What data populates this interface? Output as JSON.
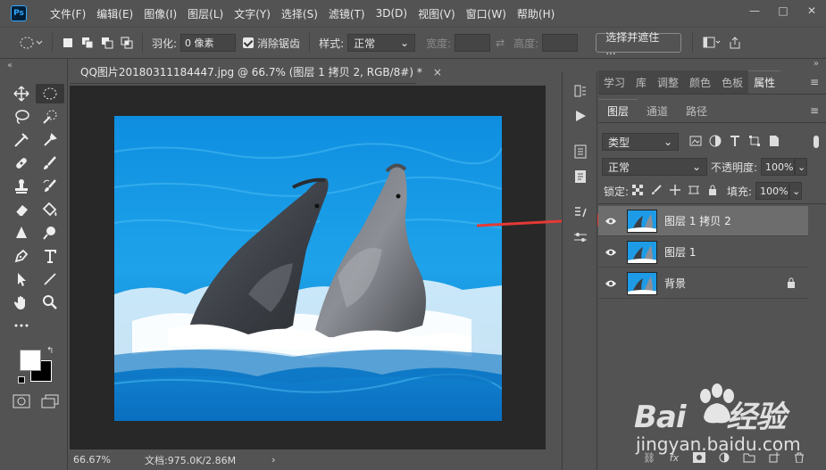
{
  "app": {
    "logo": "Ps"
  },
  "menu": [
    "文件(F)",
    "编辑(E)",
    "图像(I)",
    "图层(L)",
    "文字(Y)",
    "选择(S)",
    "滤镜(T)",
    "3D(D)",
    "视图(V)",
    "窗口(W)",
    "帮助(H)"
  ],
  "window_controls": {
    "minimize": "—",
    "maximize": "□",
    "close": "✕"
  },
  "options": {
    "feather_label": "羽化:",
    "feather_value": "0 像素",
    "antialias_label": "消除锯齿",
    "antialias_checked": true,
    "style_label": "样式:",
    "style_value": "正常",
    "width_label": "宽度:",
    "height_label": "高度:",
    "select_mask_button": "选择并遮住 ..."
  },
  "document": {
    "tab_title": "QQ图片20180311184447.jpg @ 66.7% (图层 1 拷贝 2, RGB/8#) *",
    "close": "×"
  },
  "status": {
    "zoom": "66.67%",
    "doc_size": "文档:975.0K/2.86M",
    "arrow": "›"
  },
  "panels": {
    "top_tabs": [
      "学习",
      "库",
      "调整",
      "颜色",
      "色板",
      "属性"
    ],
    "active_top_tab": "属性",
    "layer_tabs": [
      "图层",
      "通道",
      "路径"
    ],
    "active_layer_tab": "图层",
    "filter_kind": "类型",
    "blend_mode": "正常",
    "opacity_label": "不透明度:",
    "opacity_value": "100%",
    "lock_label": "锁定:",
    "fill_label": "填充:",
    "fill_value": "100%"
  },
  "layers": [
    {
      "name": "图层 1 拷贝 2",
      "selected": true,
      "locked": false
    },
    {
      "name": "图层 1",
      "selected": false,
      "locked": false
    },
    {
      "name": "背景",
      "selected": false,
      "locked": true
    }
  ],
  "colors": {
    "panel_bg": "#535353",
    "canvas_bg": "#282828",
    "selected_layer": "#6d6d6d",
    "annotation_arrow": "#e53935",
    "water": "#1e9be6"
  }
}
